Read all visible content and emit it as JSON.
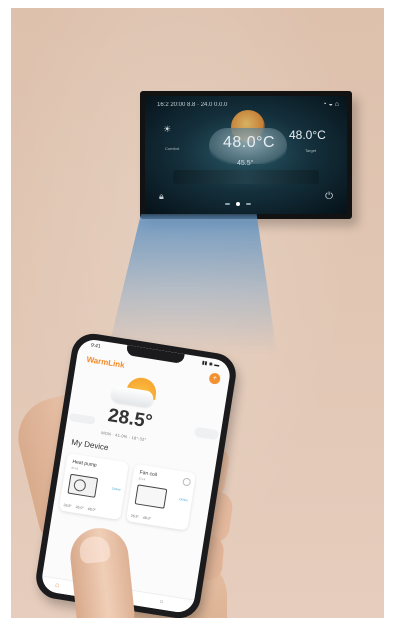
{
  "panel": {
    "status_text": "16:2  20:00  8.8  ·  24.0  0.0.0",
    "top_icons": "◔ ◒ ⌂",
    "left_temp": "☀",
    "left_label": "Comfort",
    "main_temp": "48.0°C",
    "right_temp": "48.0°C",
    "right_label": "Target",
    "sub_temp": "45.5°",
    "lock_icon": "lock-icon",
    "power_icon": "power-icon"
  },
  "phone": {
    "status_time": "9:41",
    "status_icons": "▮▮ ◉ ▬",
    "app_title": "WarmLink",
    "app_icon": "+",
    "temperature": "28.5°",
    "weather_line": "MON  ·  41.0%  ·  18°-32°",
    "my_device": "My Device",
    "devices": [
      {
        "title": "Heat pump",
        "sub": "ID  Hi",
        "status": "Online",
        "values": [
          "26.5°",
          "26.0°",
          "48.0°"
        ]
      },
      {
        "title": "Fan coil",
        "sub": "ID  Hi",
        "status": "Online",
        "values": [
          "26.5°",
          "48.0°"
        ]
      }
    ],
    "tabs": {
      "home": "⌂",
      "user": "○"
    }
  },
  "colors": {
    "accent": "#f08a2c",
    "wall": "#e1c6b3",
    "beam": "#5c90c1",
    "panel_bezel": "#121212"
  }
}
